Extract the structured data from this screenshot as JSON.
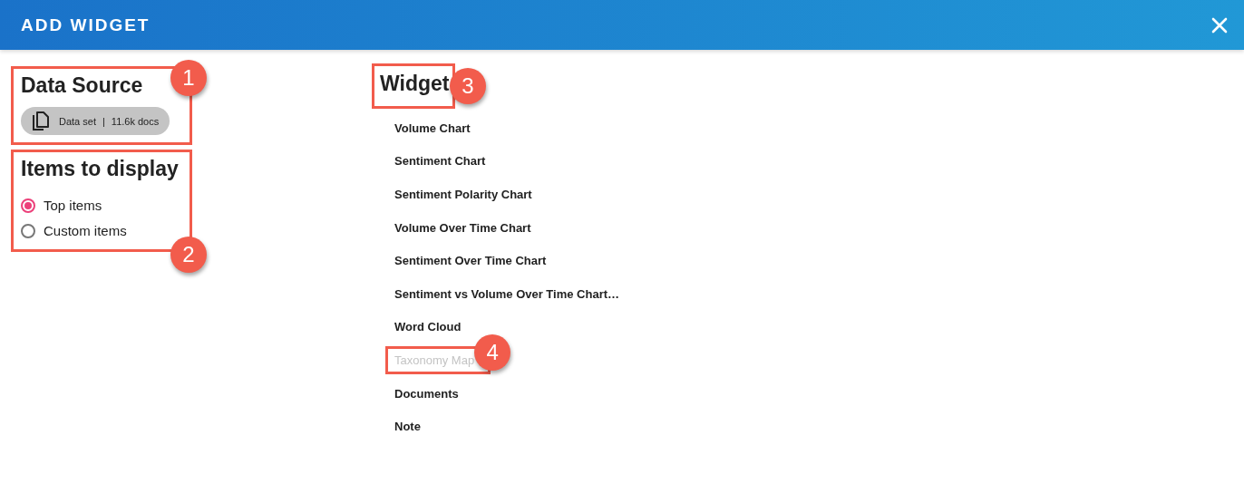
{
  "header": {
    "title": "ADD WIDGET"
  },
  "data_source": {
    "heading": "Data Source",
    "callout": "1",
    "chip": {
      "label": "Data set",
      "separator": "|",
      "count": "11.6k docs"
    }
  },
  "items_to_display": {
    "heading": "Items to display",
    "callout": "2",
    "options": [
      {
        "label": "Top items",
        "selected": true
      },
      {
        "label": "Custom items",
        "selected": false
      }
    ]
  },
  "widget": {
    "heading": "Widget",
    "callout": "3",
    "items": [
      {
        "label": "Volume Chart",
        "disabled": false
      },
      {
        "label": "Sentiment Chart",
        "disabled": false
      },
      {
        "label": "Sentiment Polarity Chart",
        "disabled": false
      },
      {
        "label": "Volume Over Time Chart",
        "disabled": false
      },
      {
        "label": "Sentiment Over Time Chart",
        "disabled": false
      },
      {
        "label": "Sentiment vs Volume Over Time Chart…",
        "disabled": false
      },
      {
        "label": "Word Cloud",
        "disabled": false
      },
      {
        "label": "Taxonomy Map",
        "disabled": true,
        "callout": "4"
      },
      {
        "label": "Documents",
        "disabled": false
      },
      {
        "label": "Note",
        "disabled": false
      }
    ]
  }
}
